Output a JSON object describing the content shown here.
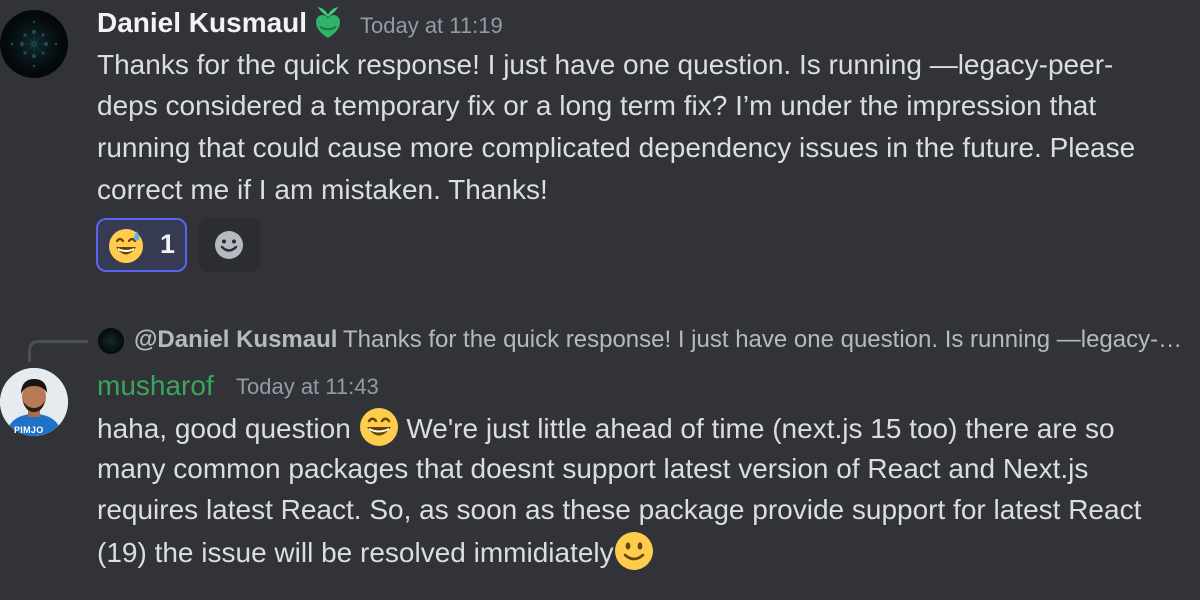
{
  "messages": [
    {
      "author": "Daniel Kusmaul",
      "role_icon": "green-leaf-heart-icon",
      "timestamp": "Today at 11:19",
      "lines": [
        "Thanks for the quick response! I just have one question. Is running —legacy-peer-",
        "deps considered a temporary fix or a long term fix? I’m under the impression that",
        "running that could cause more complicated dependency issues in the future. Please",
        "correct me if I am mistaken. Thanks!"
      ],
      "reactions": [
        {
          "emoji": "grinning-sweat-emoji",
          "count": "1",
          "selected": true
        }
      ],
      "add_reaction_icon": "add-reaction-smiley-icon"
    },
    {
      "reply_to": {
        "author": "@Daniel Kusmaul",
        "preview": "Thanks for the quick response! I just have one question. Is running —legacy-peer-deps considered a temporary fix or a long term fix?"
      },
      "author": "musharof",
      "author_color": "#3ba55d",
      "avatar_label": "PIMJO",
      "timestamp": "Today at 11:43",
      "line1_before_emoji": "haha, good question ",
      "line1_emoji": "grinning-smile-emoji",
      "line1_after_emoji": " We're just little ahead of time (next.js 15 too) there are so",
      "line2": "many common packages that doesnt support latest version of React and Next.js",
      "line3": "requires latest React. So, as soon as these package provide support for latest React",
      "line4_before_emoji": "(19) the issue will be resolved immidiately",
      "line4_emoji": "slight-smile-emoji"
    }
  ],
  "colors": {
    "background": "#313338",
    "accent": "#5865f2",
    "username_green": "#3ba55d",
    "timestamp": "#949ba4"
  }
}
